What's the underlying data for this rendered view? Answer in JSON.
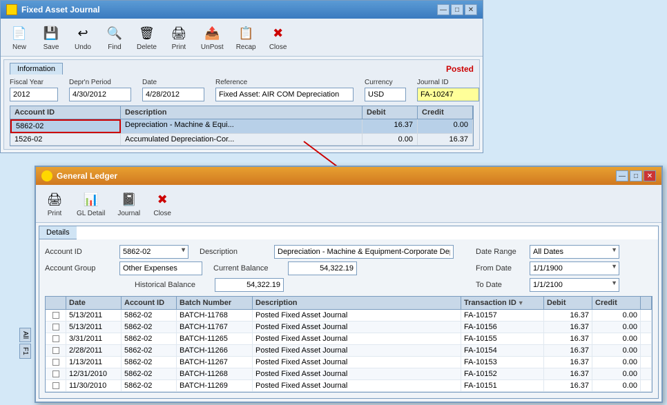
{
  "mainWindow": {
    "title": "Fixed Asset Journal",
    "toolbar": [
      {
        "id": "new",
        "label": "New",
        "icon": "📄"
      },
      {
        "id": "save",
        "label": "Save",
        "icon": "💾"
      },
      {
        "id": "undo",
        "label": "Undo",
        "icon": "↩"
      },
      {
        "id": "find",
        "label": "Find",
        "icon": "🔍"
      },
      {
        "id": "delete",
        "label": "Delete",
        "icon": "🗑"
      },
      {
        "id": "print",
        "label": "Print",
        "icon": "🖨"
      },
      {
        "id": "unpost",
        "label": "UnPost",
        "icon": "📤"
      },
      {
        "id": "recap",
        "label": "Recap",
        "icon": "📋"
      },
      {
        "id": "close",
        "label": "Close",
        "icon": "✖"
      }
    ],
    "infoTab": "Information",
    "status": "Posted",
    "form": {
      "fiscalYear": {
        "label": "Fiscal Year",
        "value": "2012"
      },
      "deprPeriod": {
        "label": "Depr'n Period",
        "value": "4/30/2012"
      },
      "date": {
        "label": "Date",
        "value": "4/28/2012"
      },
      "reference": {
        "label": "Reference",
        "value": "Fixed Asset: AIR COM Depreciation"
      },
      "currency": {
        "label": "Currency",
        "value": "USD"
      },
      "journalId": {
        "label": "Journal ID",
        "value": "FA-10247"
      }
    },
    "grid": {
      "headers": [
        "Account ID",
        "Description",
        "Debit",
        "Credit"
      ],
      "rows": [
        {
          "accountId": "5862-02",
          "description": "Depreciation - Machine & Equi...",
          "debit": "16.37",
          "credit": "0.00",
          "selected": true
        },
        {
          "accountId": "1526-02",
          "description": "Accumulated Depreciation-Cor...",
          "debit": "0.00",
          "credit": "16.37",
          "selected": false
        }
      ]
    }
  },
  "glWindow": {
    "title": "General Ledger",
    "toolbar": [
      {
        "id": "print",
        "label": "Print",
        "icon": "🖨"
      },
      {
        "id": "gldetail",
        "label": "GL Detail",
        "icon": "📊"
      },
      {
        "id": "journal",
        "label": "Journal",
        "icon": "📓"
      },
      {
        "id": "close",
        "label": "Close",
        "icon": "✖"
      }
    ],
    "detailsTab": "Details",
    "form": {
      "accountId": {
        "label": "Account ID",
        "value": "5862-02"
      },
      "accountGroup": {
        "label": "Account Group",
        "value": "Other Expenses"
      },
      "description": {
        "label": "Description",
        "value": "Depreciation - Machine & Equipment-Corporate Depe"
      },
      "currentBalance": {
        "label": "Current Balance",
        "value": "54,322.19"
      },
      "historicalBalance": {
        "label": "Historical Balance",
        "value": "54,322.19"
      },
      "dateRange": {
        "label": "Date Range",
        "value": "All Dates"
      },
      "fromDate": {
        "label": "From Date",
        "value": "1/1/1900"
      },
      "toDate": {
        "label": "To Date",
        "value": "1/1/2100"
      }
    },
    "grid": {
      "headers": [
        "",
        "Date",
        "Account ID",
        "Batch Number",
        "Description",
        "Transaction ID",
        "Debit",
        "Credit",
        ""
      ],
      "rows": [
        {
          "check": "",
          "date": "5/13/2011",
          "accountId": "5862-02",
          "batch": "BATCH-11768",
          "description": "Posted Fixed Asset Journal",
          "transactionId": "FA-10157",
          "debit": "16.37",
          "credit": "0.00"
        },
        {
          "check": "",
          "date": "5/13/2011",
          "accountId": "5862-02",
          "batch": "BATCH-11767",
          "description": "Posted Fixed Asset Journal",
          "transactionId": "FA-10156",
          "debit": "16.37",
          "credit": "0.00"
        },
        {
          "check": "",
          "date": "3/31/2011",
          "accountId": "5862-02",
          "batch": "BATCH-11265",
          "description": "Posted Fixed Asset Journal",
          "transactionId": "FA-10155",
          "debit": "16.37",
          "credit": "0.00"
        },
        {
          "check": "",
          "date": "2/28/2011",
          "accountId": "5862-02",
          "batch": "BATCH-11266",
          "description": "Posted Fixed Asset Journal",
          "transactionId": "FA-10154",
          "debit": "16.37",
          "credit": "0.00"
        },
        {
          "check": "",
          "date": "1/13/2011",
          "accountId": "5862-02",
          "batch": "BATCH-11267",
          "description": "Posted Fixed Asset Journal",
          "transactionId": "FA-10153",
          "debit": "16.37",
          "credit": "0.00"
        },
        {
          "check": "",
          "date": "12/31/2010",
          "accountId": "5862-02",
          "batch": "BATCH-11268",
          "description": "Posted Fixed Asset Journal",
          "transactionId": "FA-10152",
          "debit": "16.37",
          "credit": "0.00"
        },
        {
          "check": "",
          "date": "11/30/2010",
          "accountId": "5862-02",
          "batch": "BATCH-11269",
          "description": "Posted Fixed Asset Journal",
          "transactionId": "FA-10151",
          "debit": "16.37",
          "credit": "0.00"
        }
      ]
    }
  },
  "sidebarTabs": [
    "All",
    "F1"
  ],
  "titleBarBtns": [
    "—",
    "□",
    "✕"
  ]
}
